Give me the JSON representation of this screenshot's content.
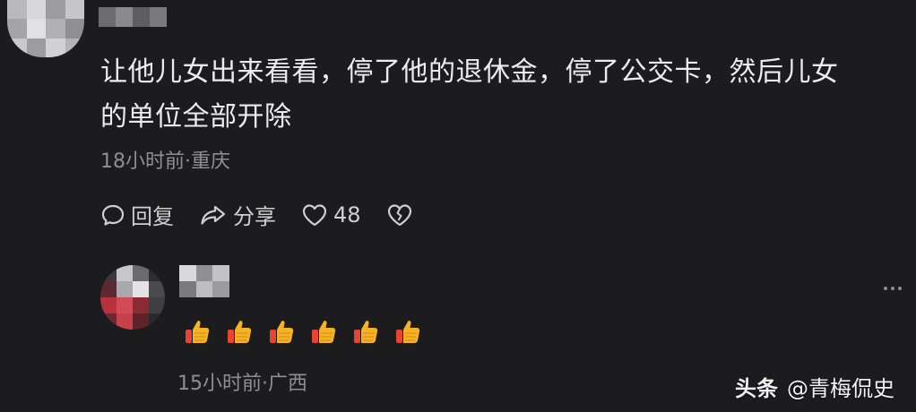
{
  "comment1": {
    "text_line1": "让他儿女出来看看，停了他的退休金，停了公交卡，然后儿女",
    "text_line2": "的单位全部开除",
    "meta": "18小时前·重庆",
    "actions": {
      "reply_label": "回复",
      "share_label": "分享",
      "like_count": "48"
    }
  },
  "comment2": {
    "emoji_count": 6,
    "emoji": "thumbs-up",
    "meta": "15小时前·广西"
  },
  "watermark": {
    "logo": "头条",
    "account": "@青梅侃史"
  },
  "colors": {
    "background": "#1c1c1f",
    "text": "#ececec",
    "meta": "#8e8e93",
    "thumb": "#f5b324"
  }
}
